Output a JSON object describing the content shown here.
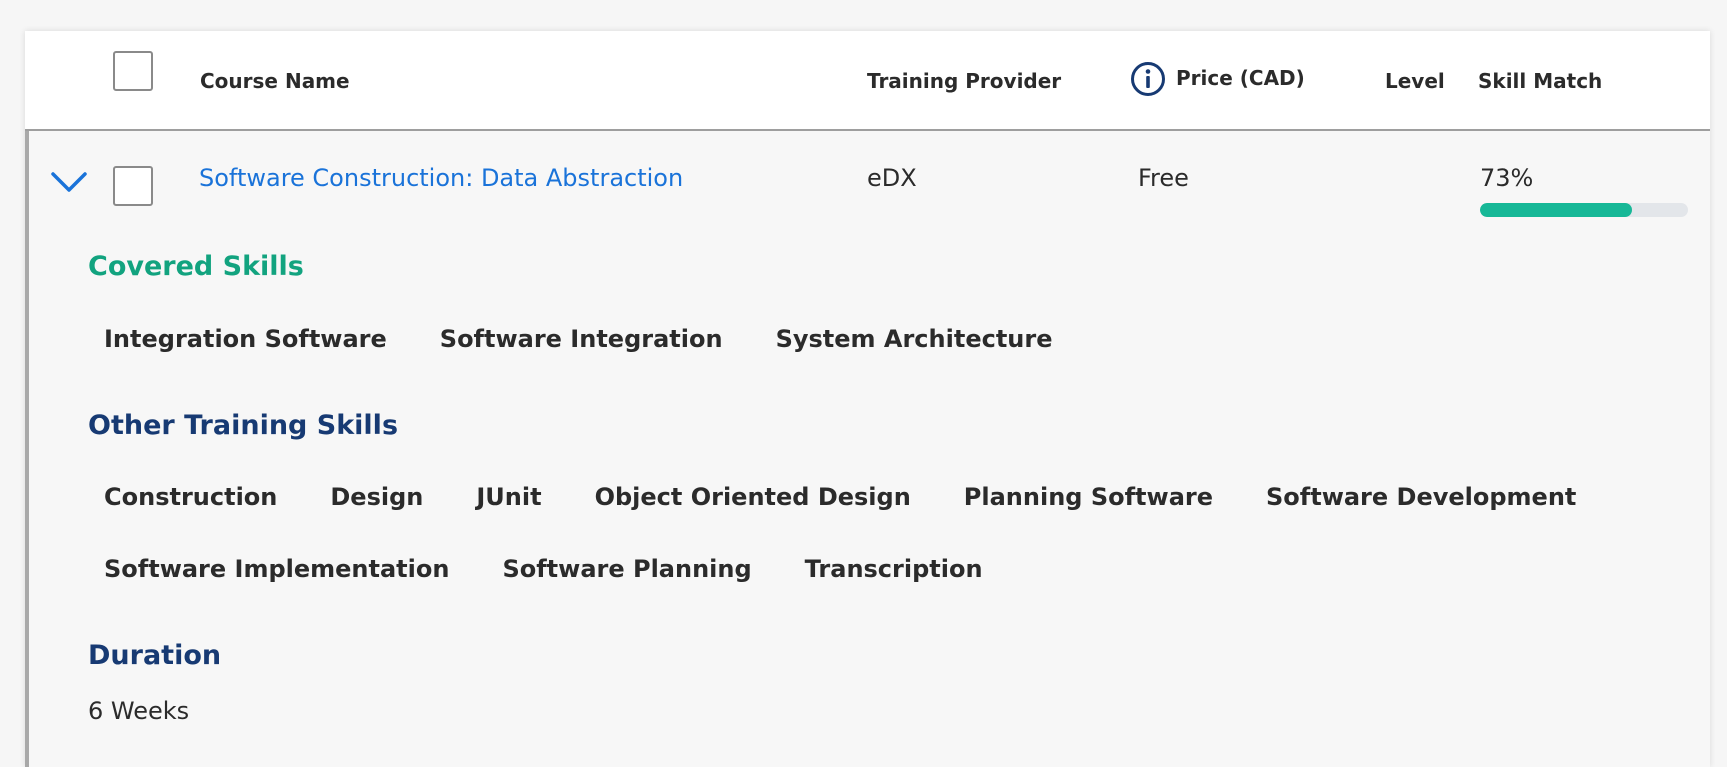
{
  "header": {
    "course_name": "Course Name",
    "training_provider": "Training Provider",
    "price": "Price (CAD)",
    "level": "Level",
    "skill_match": "Skill Match"
  },
  "course": {
    "name": "Software Construction: Data Abstraction",
    "provider": "eDX",
    "price": "Free",
    "level": "",
    "skill_match_label": "73%",
    "skill_match_value": 73
  },
  "covered_skills": {
    "title": "Covered Skills",
    "items": [
      "Integration Software",
      "Software Integration",
      "System Architecture"
    ]
  },
  "other_skills": {
    "title": "Other Training Skills",
    "row1": [
      "Construction",
      "Design",
      "JUnit",
      "Object Oriented Design",
      "Planning Software",
      "Software Development"
    ],
    "row2": [
      "Software Implementation",
      "Software Planning",
      "Transcription"
    ]
  },
  "duration": {
    "title": "Duration",
    "value": "6 Weeks"
  },
  "colors": {
    "link": "#1a73d9",
    "covered_title": "#12a37f",
    "section_title": "#173a73",
    "progress": "#17b897"
  },
  "icons": {
    "info": "info-icon",
    "expand": "chevron-down-icon"
  }
}
